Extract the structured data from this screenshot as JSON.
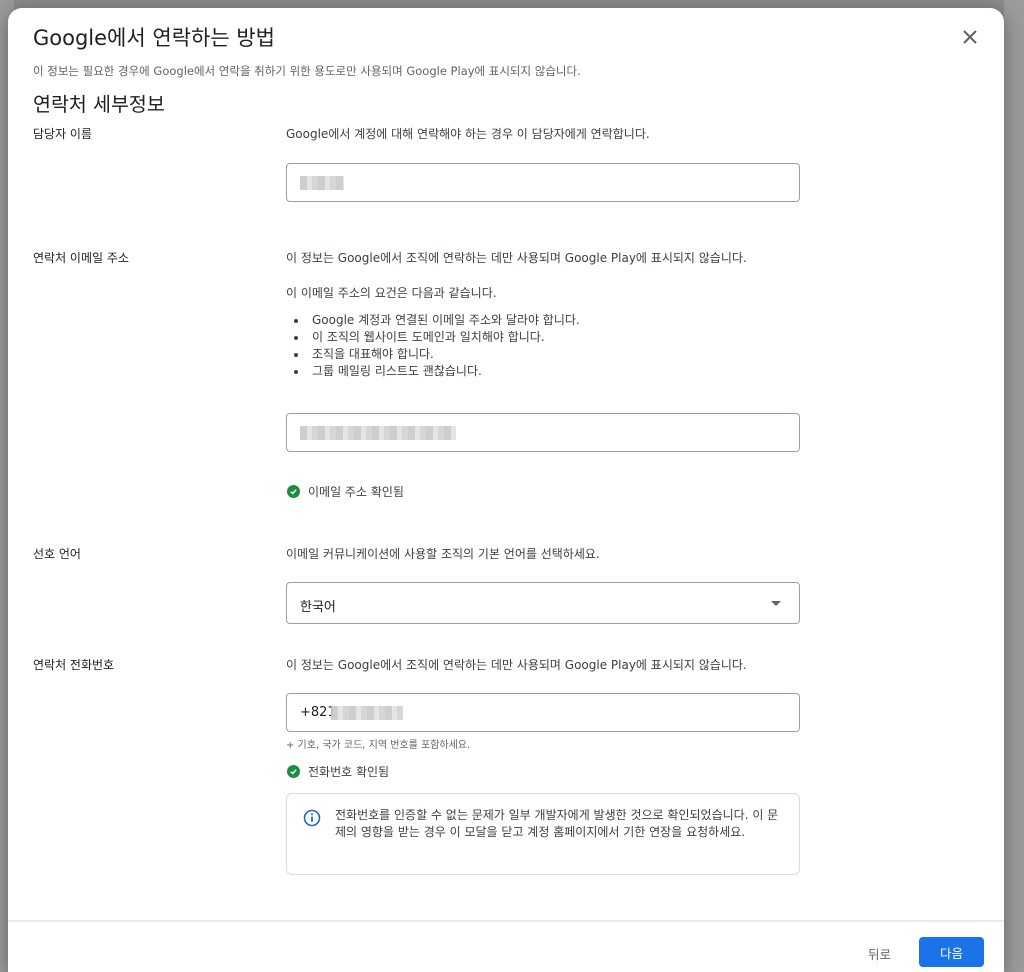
{
  "modal": {
    "title": "Google에서 연락하는 방법",
    "subtitle": "이 정보는 필요한 경우에 Google에서 연락을 취하기 위한 용도로만 사용되며 Google Play에 표시되지 않습니다.",
    "section_title": "연락처 세부정보"
  },
  "contact_name": {
    "label": "담당자 이름",
    "description": "Google에서 계정에 대해 연락해야 하는 경우 이 담당자에게 연락합니다."
  },
  "contact_email": {
    "label": "연락처 이메일 주소",
    "description": "이 정보는 Google에서 조직에 연락하는 데만 사용되며 Google Play에 표시되지 않습니다.",
    "requirements_intro": "이 이메일 주소의 요건은 다음과 같습니다.",
    "requirements": [
      "Google 계정과 연결된 이메일 주소와 달라야 합니다.",
      "이 조직의 웹사이트 도메인과 일치해야 합니다.",
      "조직을 대표해야 합니다.",
      "그룹 메일링 리스트도 괜찮습니다."
    ],
    "verified_text": "이메일 주소 확인됨"
  },
  "preferred_language": {
    "label": "선호 언어",
    "description": "이메일 커뮤니케이션에 사용할 조직의 기본 언어를 선택하세요.",
    "selected": "한국어"
  },
  "contact_phone": {
    "label": "연락처 전화번호",
    "description": "이 정보는 Google에서 조직에 연락하는 데만 사용되며 Google Play에 표시되지 않습니다.",
    "value_prefix": "+821",
    "hint": "+ 기호, 국가 코드, 지역 번호를 포함하세요.",
    "verified_text": "전화번호 확인됨",
    "info_message": "전화번호를 인증할 수 없는 문제가 일부 개발자에게 발생한 것으로 확인되었습니다. 이 문제의 영향을 받는 경우 이 모달을 닫고 계정 홈페이지에서 기한 연장을 요청하세요."
  },
  "footer": {
    "back_label": "뒤로",
    "next_label": "다음"
  },
  "colors": {
    "primary": "#1a73e8",
    "success": "#1e8e3e",
    "info_icon": "#1967d2"
  }
}
